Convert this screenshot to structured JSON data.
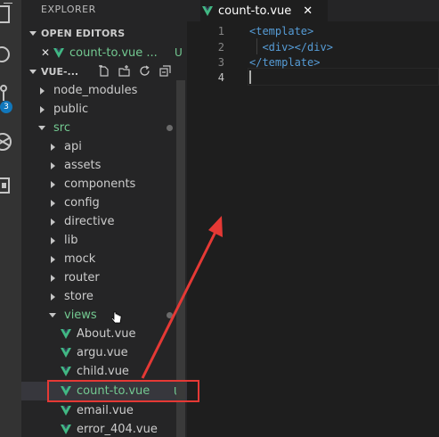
{
  "explorer": {
    "title": "EXPLORER",
    "open_editors": {
      "header": "OPEN EDITORS",
      "items": [
        {
          "name": "count-to.vue ...",
          "status": "U"
        }
      ]
    },
    "project": {
      "name": "VUE-..."
    },
    "tree": [
      {
        "label": "node_modules"
      },
      {
        "label": "public"
      },
      {
        "label": "src"
      },
      {
        "label": "api"
      },
      {
        "label": "assets"
      },
      {
        "label": "components"
      },
      {
        "label": "config"
      },
      {
        "label": "directive"
      },
      {
        "label": "lib"
      },
      {
        "label": "mock"
      },
      {
        "label": "router"
      },
      {
        "label": "store"
      },
      {
        "label": "views"
      },
      {
        "label": "About.vue"
      },
      {
        "label": "argu.vue"
      },
      {
        "label": "child.vue"
      },
      {
        "label": "count-to.vue",
        "status": "U"
      },
      {
        "label": "email.vue"
      },
      {
        "label": "error_404.vue"
      }
    ]
  },
  "activity": {
    "badge": "3"
  },
  "editor": {
    "tab": {
      "name": "count-to.vue",
      "close": "✕"
    },
    "lines": [
      {
        "num": "1",
        "text": "<template>"
      },
      {
        "num": "2",
        "text": "  <div></div>"
      },
      {
        "num": "3",
        "text": "</template>"
      },
      {
        "num": "4",
        "text": ""
      }
    ]
  },
  "colors": {
    "untracked_green": "#73c991",
    "tag_blue": "#569cd6",
    "badge_blue": "#1177bb",
    "annotation_red": "#e53935",
    "vue_green": "#41b883"
  }
}
